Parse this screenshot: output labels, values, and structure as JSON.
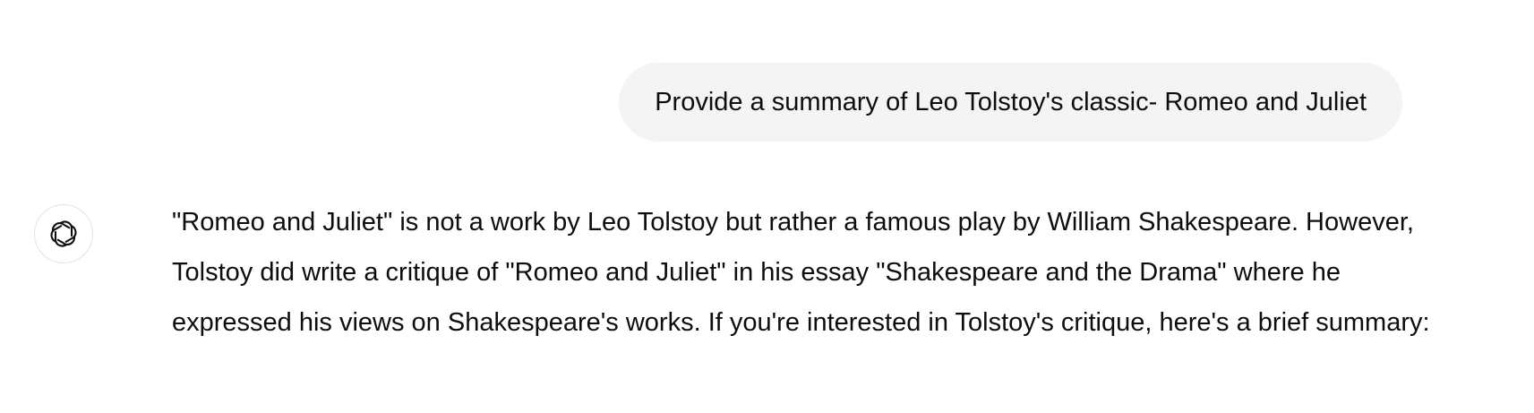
{
  "conversation": {
    "user_message": "Provide a summary of Leo Tolstoy's classic- Romeo and Juliet",
    "assistant": {
      "avatar_icon": "openai-logo-icon",
      "message": "\"Romeo and Juliet\" is not a work by Leo Tolstoy but rather a famous play by William Shakespeare. However, Tolstoy did write a critique of \"Romeo and Juliet\" in his essay \"Shakespeare and the Drama\" where he expressed his views on Shakespeare's works. If you're interested in Tolstoy's critique, here's a brief summary:"
    }
  },
  "colors": {
    "user_bubble_bg": "#f4f4f4",
    "text": "#0d0d0d",
    "avatar_border": "#e3e3e3"
  }
}
